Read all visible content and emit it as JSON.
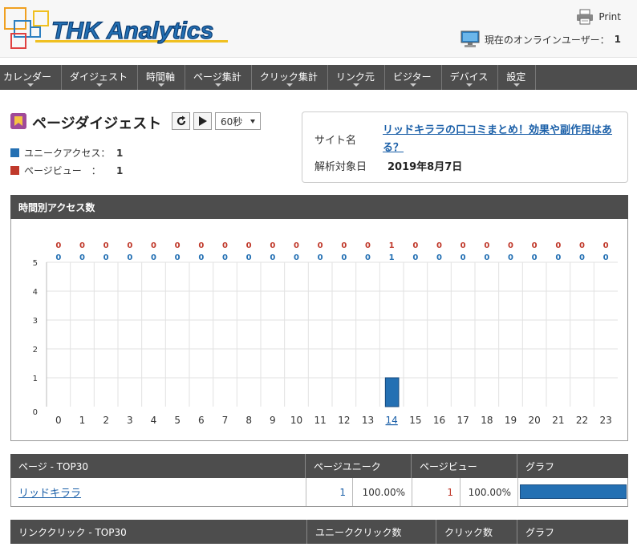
{
  "header": {
    "logo_text": "THK Analytics",
    "print_label": "Print",
    "online_label": "現在のオンラインユーザー：",
    "online_count": "1"
  },
  "nav": {
    "items": [
      {
        "label": "カレンダー",
        "dropdown": true
      },
      {
        "label": "ダイジェスト",
        "dropdown": true
      },
      {
        "label": "時間軸",
        "dropdown": true
      },
      {
        "label": "ページ集計",
        "dropdown": true
      },
      {
        "label": "クリック集計",
        "dropdown": true
      },
      {
        "label": "リンク元",
        "dropdown": true
      },
      {
        "label": "ビジター",
        "dropdown": true
      },
      {
        "label": "デバイス",
        "dropdown": true
      },
      {
        "label": "設定",
        "dropdown": true
      }
    ]
  },
  "page": {
    "title": "ページダイジェスト",
    "interval": "60秒"
  },
  "legend": {
    "unique_label": "ユニークアクセス：",
    "unique_value": "1",
    "pv_label": "ページビュー　：",
    "pv_value": "1"
  },
  "site": {
    "name_label": "サイト名",
    "name_value": "リッドキララの口コミまとめ！効果や副作用はある？",
    "date_label": "解析対象日",
    "date_value": "2019年8月7日"
  },
  "chart_panel": {
    "title": "時間別アクセス数"
  },
  "chart_data": {
    "type": "bar",
    "categories": [
      "0",
      "1",
      "2",
      "3",
      "4",
      "5",
      "6",
      "7",
      "8",
      "9",
      "10",
      "11",
      "12",
      "13",
      "14",
      "15",
      "16",
      "17",
      "18",
      "19",
      "20",
      "21",
      "22",
      "23"
    ],
    "highlighted_category": "14",
    "series": [
      {
        "name": "ページビュー",
        "color": "#c0392b",
        "values": [
          0,
          0,
          0,
          0,
          0,
          0,
          0,
          0,
          0,
          0,
          0,
          0,
          0,
          0,
          1,
          0,
          0,
          0,
          0,
          0,
          0,
          0,
          0,
          0
        ]
      },
      {
        "name": "ユニークアクセス",
        "color": "#2470b3",
        "values": [
          0,
          0,
          0,
          0,
          0,
          0,
          0,
          0,
          0,
          0,
          0,
          0,
          0,
          0,
          1,
          0,
          0,
          0,
          0,
          0,
          0,
          0,
          0,
          0
        ]
      }
    ],
    "ylim": [
      0,
      5
    ],
    "yticks": [
      "0",
      "1",
      "2",
      "3",
      "4",
      "5"
    ],
    "grid": true,
    "xlabel": "",
    "ylabel": ""
  },
  "pages_table": {
    "headers": [
      "ページ - TOP30",
      "ページユニーク",
      "ページビュー",
      "グラフ"
    ],
    "rows": [
      {
        "page": "リッドキララ",
        "unique": "1",
        "unique_pct": "100.00%",
        "pv": "1",
        "pv_pct": "100.00%",
        "fraction": 1.0
      }
    ]
  },
  "link_table": {
    "headers": [
      "リンククリック - TOP30",
      "ユニーククリック数",
      "クリック数",
      "グラフ"
    ]
  },
  "colors": {
    "nav_bg": "#4d4d4d",
    "unique": "#2470b3",
    "pageview": "#c0392b",
    "link": "#1a5fa8"
  }
}
